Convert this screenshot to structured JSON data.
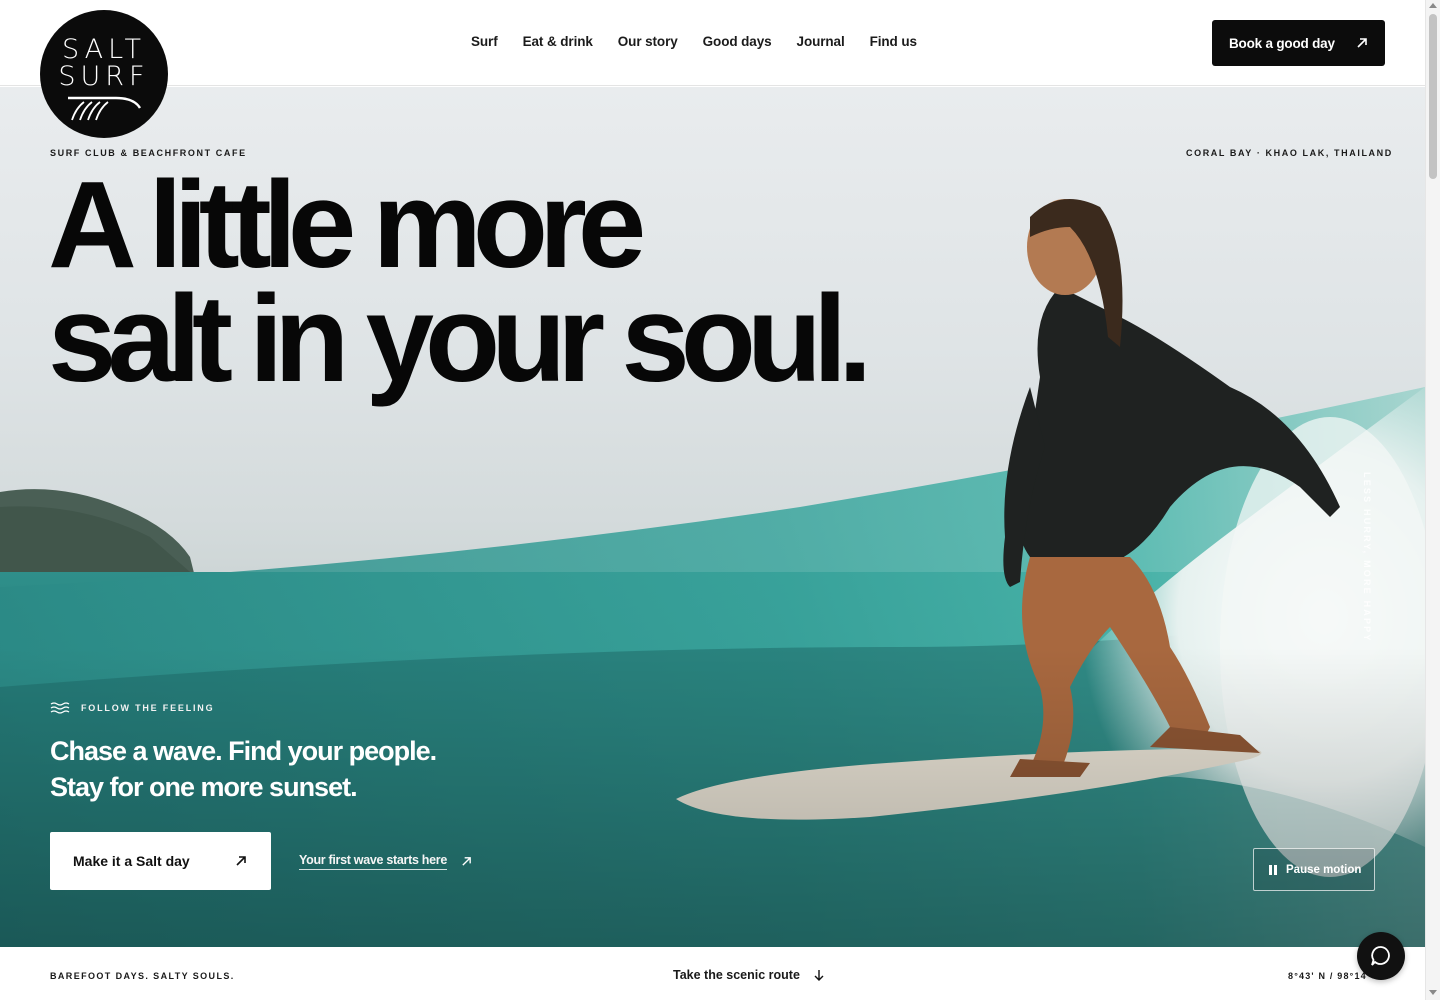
{
  "brand": {
    "logo_line1": "SALT",
    "logo_line2": "SURF"
  },
  "nav": {
    "items": [
      "Surf",
      "Eat & drink",
      "Our story",
      "Good days",
      "Journal",
      "Find us"
    ],
    "book_label": "Book a good day"
  },
  "hero": {
    "eyebrow_left": "SURF CLUB & BEACHFRONT CAFE",
    "eyebrow_right": "CORAL BAY · KHAO LAK, THAILAND",
    "headline_line1": "A little more",
    "headline_line2": "salt in your soul.",
    "tagline": "FOLLOW THE FEELING",
    "sub_line1": "Chase a wave. Find your people.",
    "sub_line2": "Stay for one more sunset.",
    "cta_label": "Make it a Salt day",
    "link_label": "Your first wave starts here",
    "pause_label": "Pause motion",
    "vertical_text": "LESS HURRY, MORE HAPPY"
  },
  "footer_bar": {
    "left": "BAREFOOT DAYS. SALTY SOULS.",
    "middle": "Take the scenic route",
    "right": "8°43' N / 98°14' E"
  },
  "icons": {
    "book": "arrow-up-right-icon",
    "cta": "arrow-up-right-icon",
    "link": "arrow-up-right-icon",
    "tagline": "waves-icon",
    "pause": "pause-icon",
    "scroll": "arrow-down-icon",
    "chat": "chat-bubble-icon"
  },
  "colors": {
    "ink": "#0b0b0b",
    "sea": "#2a8c88",
    "paper": "#ffffff"
  }
}
